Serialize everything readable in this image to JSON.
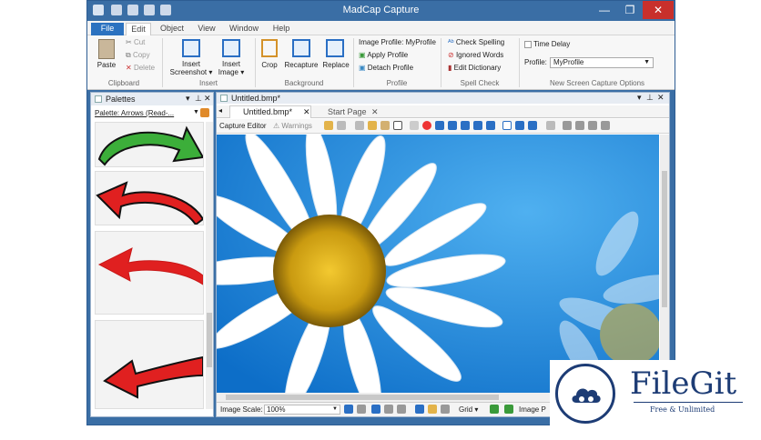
{
  "window": {
    "title": "MadCap Capture",
    "controls": {
      "minimize": "—",
      "restore": "❐",
      "close": "✕"
    }
  },
  "ribbon_tabs": [
    "File",
    "Edit",
    "Object",
    "View",
    "Window",
    "Help"
  ],
  "active_tab": "Edit",
  "ribbon": {
    "clipboard": {
      "paste": "Paste",
      "cut": "Cut",
      "copy": "Copy",
      "delete": "Delete",
      "label": "Clipboard"
    },
    "insert": {
      "screenshot": "Insert\nScreenshot ▾",
      "image": "Insert\nImage ▾",
      "label": "Insert"
    },
    "background": {
      "crop": "Crop",
      "recapture": "Recapture",
      "replace": "Replace",
      "label": "Background"
    },
    "profile": {
      "image_profile": "Image Profile: MyProfile",
      "apply": "Apply Profile",
      "detach": "Detach Profile",
      "label": "Profile"
    },
    "spell": {
      "check": "Check Spelling",
      "ignored": "Ignored Words",
      "dictionary": "Edit Dictionary",
      "label": "Spell Check"
    },
    "capture": {
      "time_delay": "Time Delay",
      "profile_label": "Profile:",
      "profile_value": "MyProfile",
      "label": "New Screen Capture Options"
    }
  },
  "palettes": {
    "title": "Palettes",
    "selector": "Palette: Arrows (Read-..."
  },
  "document": {
    "file_tab": "Untitled.bmp*",
    "tabs": [
      "Untitled.bmp*",
      "Start Page"
    ],
    "toolbar": {
      "editor": "Capture Editor",
      "warnings": "Warnings"
    }
  },
  "status": {
    "scale_label": "Image Scale:",
    "scale_value": "100%",
    "grid": "Grid",
    "image_p": "Image P"
  },
  "watermark": {
    "name": "FileGit",
    "tagline": "Free & Unlimited"
  },
  "colors": {
    "titlebar": "#3a6ea5",
    "file_tab": "#2b72c0",
    "sky": "#1a7fd6",
    "green_arrow": "#3cae3a",
    "red_arrow": "#e02020",
    "close": "#c8302c"
  }
}
